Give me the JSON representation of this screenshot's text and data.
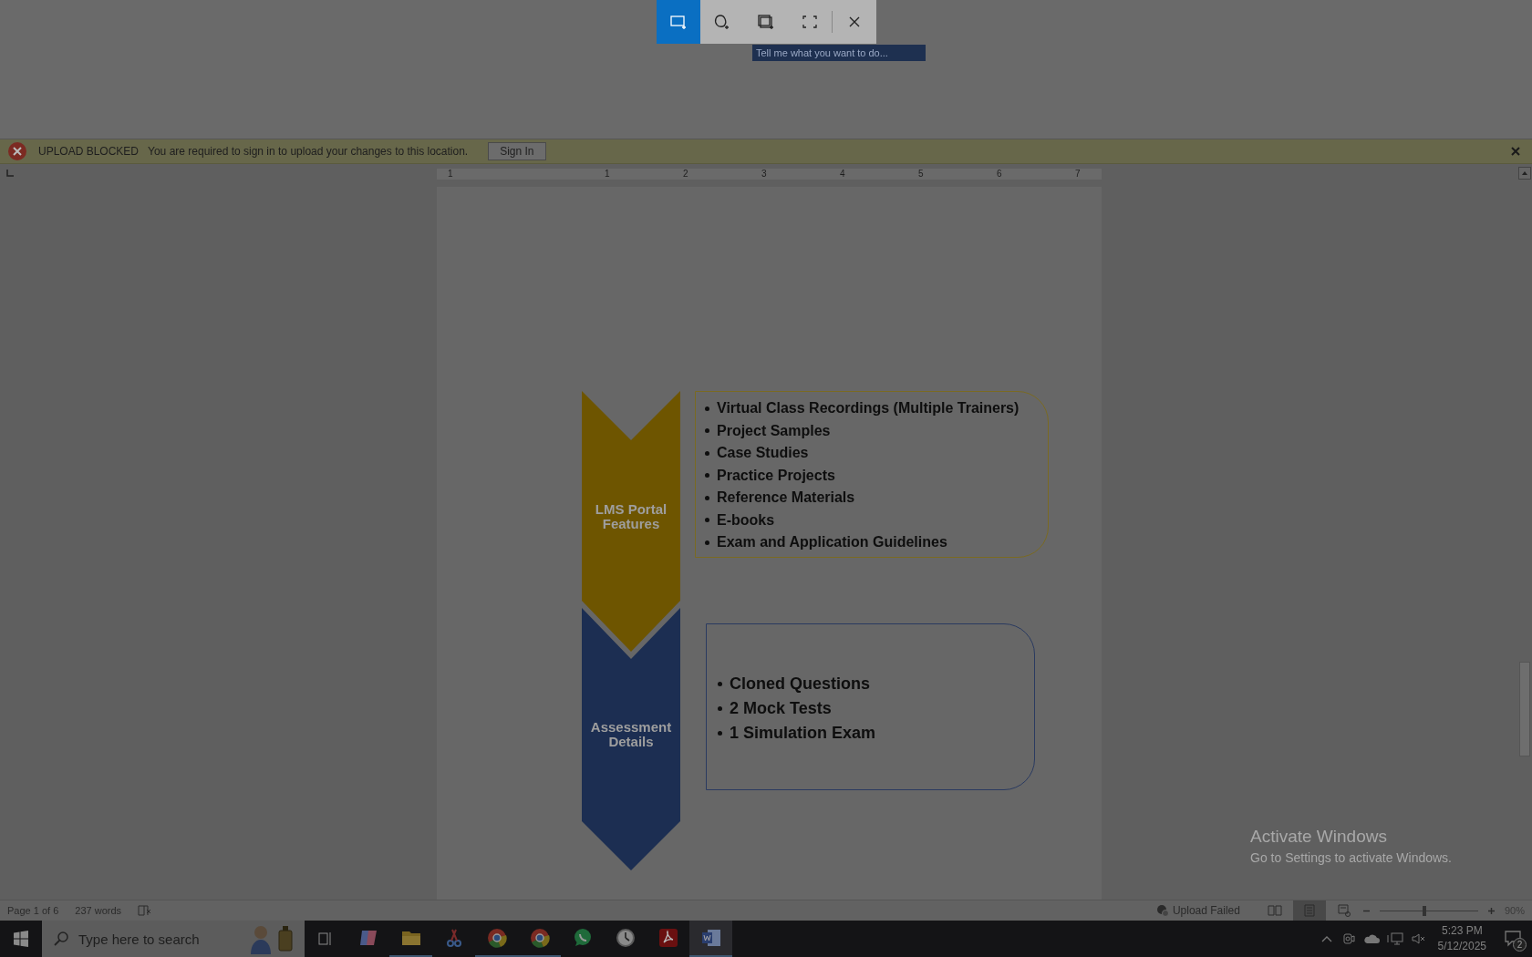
{
  "snip_toolbar": {
    "modes": [
      {
        "kind": "rectangle",
        "selected": true
      },
      {
        "kind": "freeform",
        "selected": false
      },
      {
        "kind": "window",
        "selected": false
      },
      {
        "kind": "fullscreen",
        "selected": false
      }
    ]
  },
  "tell_me": {
    "placeholder": "Tell me what you want to do..."
  },
  "message_bar": {
    "title": "UPLOAD BLOCKED",
    "message": "You are required to sign in to upload your changes to this location.",
    "button": "Sign In"
  },
  "ruler": {
    "numbers": [
      "1",
      "1",
      "2",
      "3",
      "4",
      "5",
      "6",
      "7"
    ]
  },
  "diagram": {
    "stages": [
      {
        "label": "LMS Portal Features",
        "color": "#6e5500",
        "items": [
          "Virtual Class Recordings (Multiple Trainers)",
          "Project Samples",
          "Case Studies",
          "Practice Projects",
          "Reference Materials",
          "E-books",
          "Exam and Application Guidelines"
        ]
      },
      {
        "label": "Assessment Details",
        "color": "#1c2e52",
        "items": [
          "Cloned Questions",
          "2 Mock Tests",
          "1  Simulation Exam"
        ]
      }
    ]
  },
  "status_bar": {
    "page": "Page 1 of 6",
    "words": "237 words",
    "upload": "Upload Failed",
    "views": [
      {
        "kind": "read",
        "selected": false
      },
      {
        "kind": "print",
        "selected": true
      },
      {
        "kind": "web",
        "selected": false
      }
    ],
    "zoom": {
      "level": 0.45,
      "reading": "90%"
    }
  },
  "activation": {
    "title": "Activate Windows",
    "message": "Go to Settings to activate Windows."
  },
  "taskbar": {
    "search": {
      "placeholder": "Type here to search"
    },
    "apps": [
      {
        "kind": "copilot",
        "running": false,
        "active": false
      },
      {
        "kind": "explorer",
        "running": true,
        "active": false
      },
      {
        "kind": "snipping",
        "running": false,
        "active": false
      },
      {
        "kind": "chrome",
        "running": true,
        "active": false
      },
      {
        "kind": "chrome",
        "running": true,
        "active": false
      },
      {
        "kind": "whatsapp",
        "running": false,
        "active": false
      },
      {
        "kind": "clock",
        "running": false,
        "active": false
      },
      {
        "kind": "acrobat",
        "running": false,
        "active": false
      },
      {
        "kind": "word",
        "running": true,
        "active": true
      }
    ],
    "time": "5:23 PM",
    "date": "5/12/2025",
    "notifications": "2"
  }
}
